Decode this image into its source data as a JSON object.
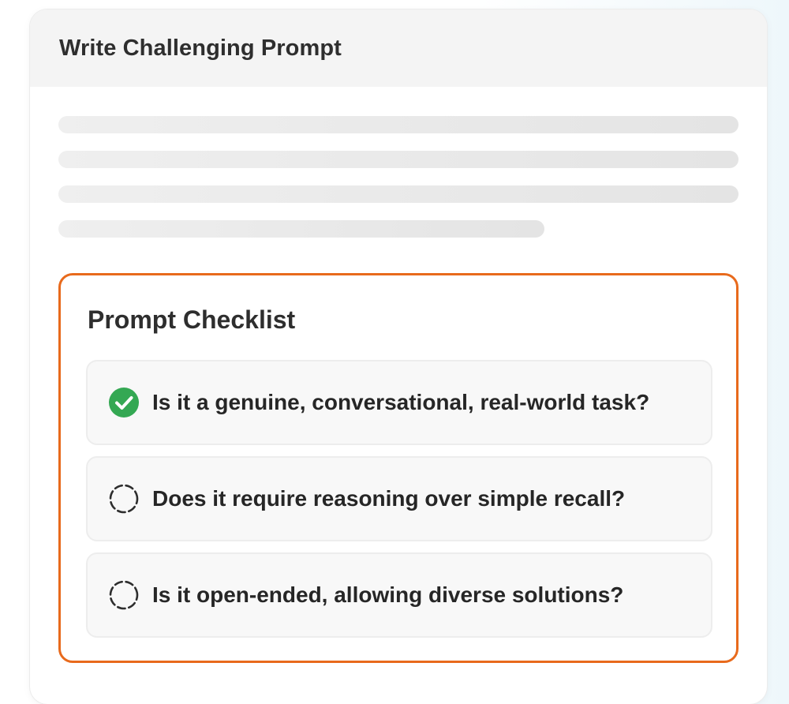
{
  "card": {
    "title": "Write Challenging Prompt"
  },
  "checklist": {
    "title": "Prompt Checklist",
    "accent_color": "#e86a1c",
    "items": [
      {
        "label": "Is it a genuine, conversational, real-world task?",
        "checked": true,
        "icon": "check-circle-icon"
      },
      {
        "label": "Does it require reasoning over simple recall?",
        "checked": false,
        "icon": "dashed-circle-icon"
      },
      {
        "label": "Is it open-ended, allowing diverse solutions?",
        "checked": false,
        "icon": "dashed-circle-icon"
      }
    ]
  },
  "colors": {
    "checked_green": "#34a853",
    "pending_gray": "#2e2e2e"
  }
}
